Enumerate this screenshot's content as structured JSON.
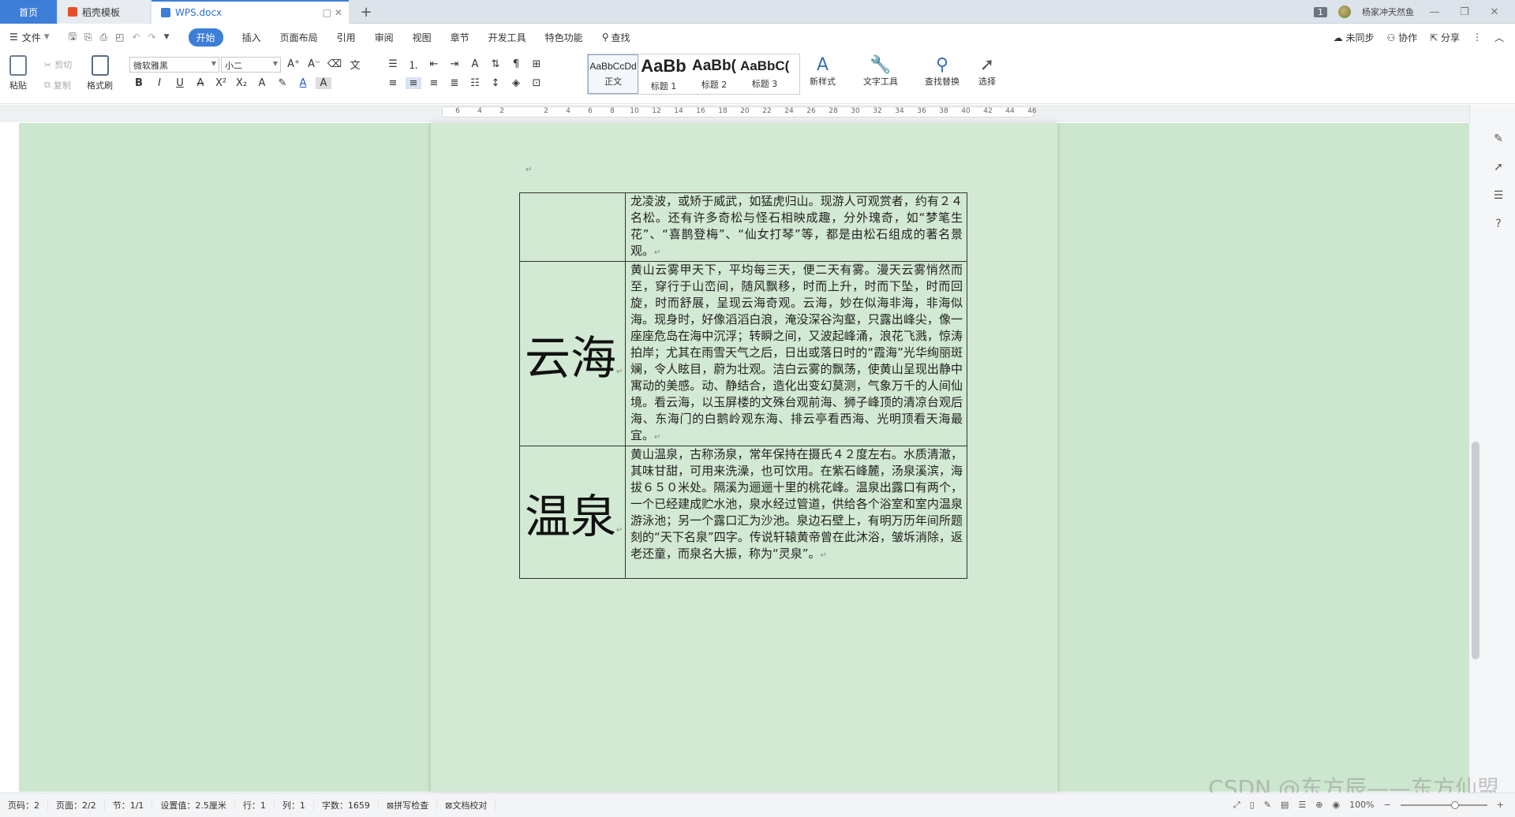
{
  "tabs": {
    "home": "首页",
    "template": "稻壳模板",
    "doc": "WPS.docx"
  },
  "window": {
    "badge": "1",
    "user": "杨家冲天然鱼"
  },
  "menu": {
    "file": "文件",
    "items": [
      "开始",
      "插入",
      "页面布局",
      "引用",
      "审阅",
      "视图",
      "章节",
      "开发工具",
      "特色功能"
    ],
    "search": "查找",
    "sync": "未同步",
    "collab": "协作",
    "share": "分享"
  },
  "ribbon": {
    "paste": "粘贴",
    "cut": "剪切",
    "copy": "复制",
    "format_painter": "格式刷",
    "font_name": "微软雅黑",
    "font_size": "小二",
    "styles": [
      {
        "sample": "AaBbCcDd",
        "label": "正文"
      },
      {
        "sample": "AaBb",
        "label": "标题 1"
      },
      {
        "sample": "AaBb(",
        "label": "标题 2"
      },
      {
        "sample": "AaBbC(",
        "label": "标题 3"
      }
    ],
    "new_style": "新样式",
    "text_tools": "文字工具",
    "find_replace": "查找替换",
    "select": "选择"
  },
  "ruler": [
    "6",
    "4",
    "2",
    "",
    "2",
    "4",
    "6",
    "8",
    "10",
    "12",
    "14",
    "16",
    "18",
    "20",
    "22",
    "24",
    "26",
    "28",
    "30",
    "32",
    "34",
    "36",
    "38",
    "40",
    "42",
    "44",
    "46"
  ],
  "table": {
    "rows": [
      {
        "heading": "",
        "text": "龙凌波，或矫于威武，如猛虎归山。现游人可观赏者，约有２４名松。还有许多奇松与怪石相映成趣，分外瑰奇，如“梦笔生花”、“喜鹊登梅”、“仙女打琴”等，都是由松石组成的著名景观。"
      },
      {
        "heading": "云海",
        "text": "黄山云雾甲天下，平均每三天，便二天有雾。漫天云雾悄然而至，穿行于山峦间，随风飘移，时而上升，时而下坠，时而回旋，时而舒展，呈现云海奇观。云海，妙在似海非海，非海似海。现身时，好像滔滔白浪，淹没深谷沟壑，只露出峰尖，像一座座危岛在海中沉浮；转瞬之间，又波起峰涌，浪花飞溅，惊涛拍岸；尤其在雨雪天气之后，日出或落日时的“霞海”光华绚丽斑斓，令人眩目，蔚为壮观。洁白云雾的飘荡，使黄山呈现出静中寓动的美感。动、静结合，造化出变幻莫测，气象万千的人间仙境。看云海，以玉屏楼的文殊台观前海、狮子峰顶的清凉台观后海、东海门的白鹅岭观东海、排云亭看西海、光明顶看天海最宜。"
      },
      {
        "heading": "温泉",
        "text": "黄山温泉，古称汤泉，常年保持在摄氏４２度左右。水质清澈，其味甘甜，可用来洗澡，也可饮用。在紫石峰麓，汤泉溪滨，海拔６５０米处。隔溪为逦逦十里的桃花峰。温泉出露口有两个，一个已经建成贮水池，泉水经过管道，供给各个浴室和室内温泉游泳池；另一个露口汇为沙池。泉边石壁上，有明万历年间所题刻的“天下名泉”四字。传说轩辕黄帝曾在此沐浴，皱坼消除，返老还童，而泉名大振，称为“灵泉”。"
      }
    ]
  },
  "status": {
    "page_no": "页码：2",
    "pages": "页面：2/2",
    "section": "节：1/1",
    "setting": "设置值：2.5厘米",
    "row": "行：1",
    "col": "列：1",
    "words": "字数：1659",
    "spell": "拼写检查",
    "proof": "文档校对",
    "zoom": "100%"
  },
  "watermark": "CSDN @东方辰——东方仙盟",
  "colors": {
    "accent": "#3c7ed8",
    "doc_bg": "#cde6ce"
  }
}
